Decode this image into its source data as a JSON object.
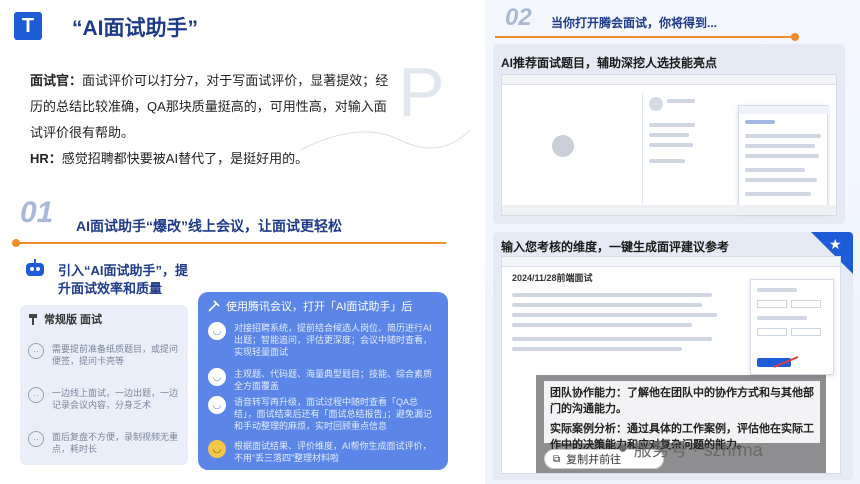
{
  "header": {
    "logo_glyph": "T",
    "title": "“AI面试助手”"
  },
  "quote": {
    "line1_label": "面试官：",
    "line1_text": "面试评价可以打分7，对于写面试评价，显著提效；经历的总结比较准确，QA那块质量挺高的，可用性高，对输入面试评价很有帮助。",
    "line2_label": "HR：",
    "line2_text": "感觉招聘都快要被AI替代了，是挺好用的。",
    "bg_letter": "P"
  },
  "section01": {
    "number": "01",
    "title": "AI面试助手“爆改”线上会议，让面试更轻松",
    "intro": "引入“AI面试助手”，提升面试效率和质量"
  },
  "left_panel": {
    "heading": "常规版 面试",
    "items": [
      "需要提前准备纸质题目，或提问便签，提问卡壳等",
      "一边线上面试，一边出题，一边记录会议内容，分身乏术",
      "面后复盘不方便，录制视频无重点，耗时长"
    ]
  },
  "right_panel": {
    "heading": "使用腾讯会议，打开「AI面试助手」后",
    "items": [
      "对接招聘系统，提前结合候选人岗位、简历进行AI出题；智能追问，评估更深度；会议中随时查看，实现轻量面试",
      "主观题、代码题、海量典型题目；技能、综合素质全方面覆盖",
      "语音转写再升级，面试过程中随时查看「QA总结」，面试结束后还有「面试总结报告」；避免漏记和手动整理的麻烦，实时回顾重点信息",
      "根据面试结果、评价维度，AI帮你生成面试评价，不用“丢三落四”整理材料啦"
    ]
  },
  "section02": {
    "number": "02",
    "title": "当你打开腾会面试，你将得到..."
  },
  "shot1": {
    "label": "AI推荐面试题目，辅助深挖人选技能亮点"
  },
  "shot2": {
    "label": "输入您考核的维度，一键生成面评建议参考",
    "doc_title": "2024/11/28前端面试",
    "overlay_lines": [
      "团队协作能力：了解他在团队中的协作方式和与其他部门的沟通能力。",
      "实际案例分析：通过具体的工作案例，评估他在实际工作中的决策能力和应对复杂问题的能力。"
    ],
    "copy_label": "复制并前往"
  },
  "watermark": "服务号 · szhrma",
  "colors": {
    "brand": "#1e5bd6",
    "accent_orange": "#f08c2a",
    "panel_blue": "#5b86e8"
  }
}
